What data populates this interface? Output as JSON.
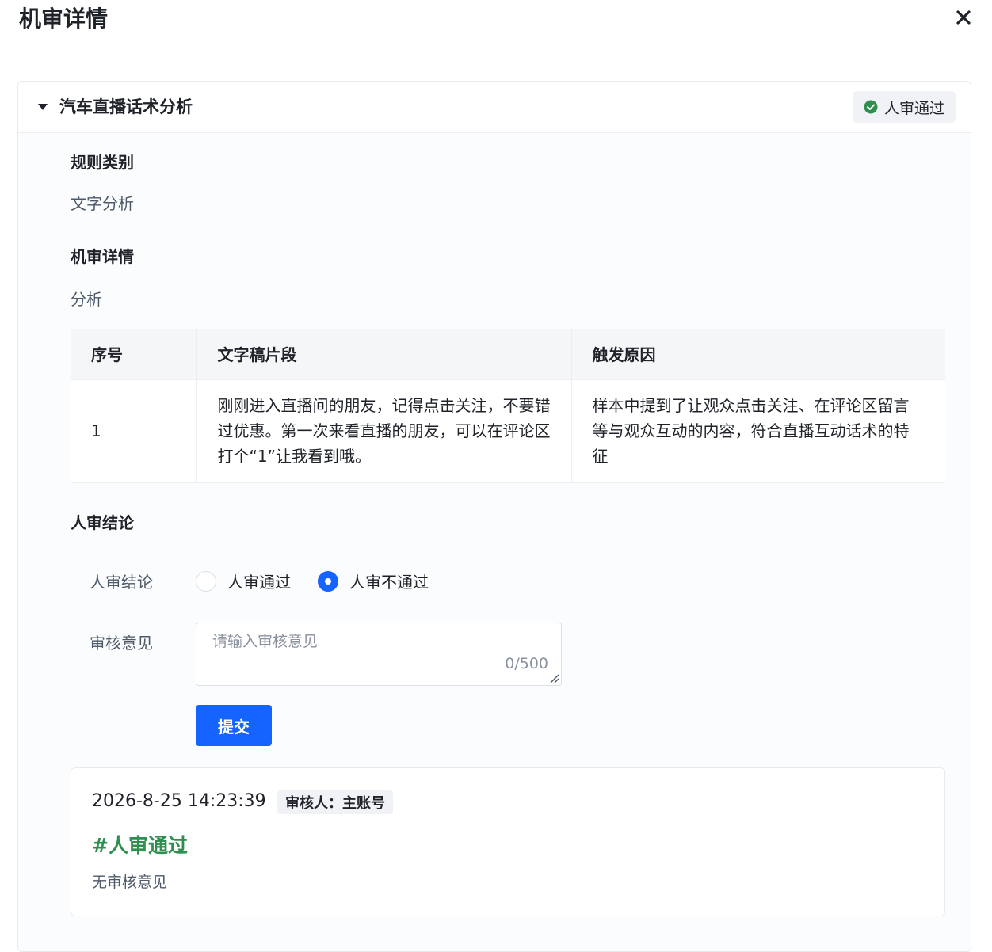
{
  "dialog": {
    "title": "机审详情",
    "close_icon": "close-icon"
  },
  "card": {
    "title": "汽车直播话术分析",
    "status_label": "人审通过",
    "status_color": "#2f8f4e"
  },
  "rule": {
    "label": "规则类别",
    "value": "文字分析"
  },
  "machine": {
    "label": "机审详情",
    "value": "分析"
  },
  "table": {
    "headers": [
      "序号",
      "文字稿片段",
      "触发原因"
    ],
    "rows": [
      {
        "index": "1",
        "fragment": "刚刚进入直播间的朋友，记得点击关注，不要错过优惠。第一次来看直播的朋友，可以在评论区打个“1”让我看到哦。",
        "reason": "样本中提到了让观众点击关注、在评论区留言等与观众互动的内容，符合直播互动话术的特征"
      }
    ]
  },
  "review": {
    "section_label": "人审结论",
    "conclusion_label": "人审结论",
    "options": [
      {
        "label": "人审通过",
        "checked": false
      },
      {
        "label": "人审不通过",
        "checked": true
      }
    ],
    "opinion_label": "审核意见",
    "opinion_placeholder": "请输入审核意见",
    "opinion_value": "",
    "counter": "0/500",
    "submit_label": "提交",
    "accent_color": "#1664ff"
  },
  "record": {
    "time": "2026-8-25 14:23:39",
    "reviewer": "审核人：主账号",
    "verdict": "#人审通过",
    "comment": "无审核意见"
  }
}
